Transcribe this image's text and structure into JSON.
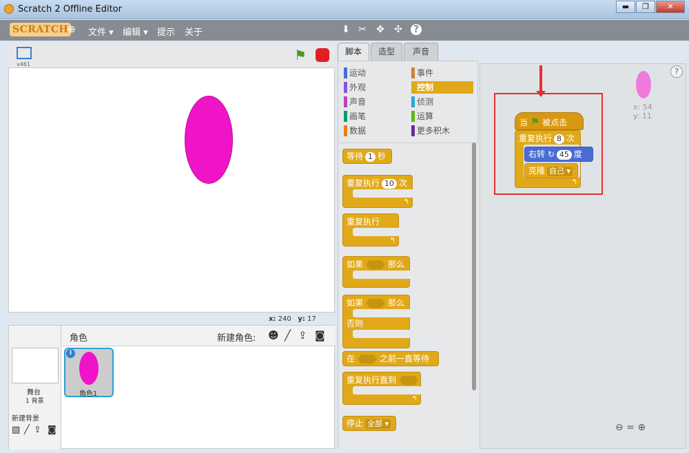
{
  "window": {
    "title": "Scratch 2 Offline Editor",
    "min": "▬",
    "max": "❐",
    "close": "✕"
  },
  "menu": {
    "logo": "SCRATCH",
    "file": "文件 ▾",
    "edit": "编辑 ▾",
    "tips": "提示",
    "about": "关于"
  },
  "stage": {
    "version": "v461",
    "coord_x_label": "x:",
    "coord_x": "240",
    "coord_y_label": "y:",
    "coord_y": "17"
  },
  "sprites": {
    "header_label": "角色",
    "new_sprite_label": "新建角色:",
    "stage_label": "舞台",
    "stage_bg_count": "1 背景",
    "new_backdrop_label": "新建背景",
    "sprite_name": "角色1",
    "info": "i"
  },
  "tabs": [
    "脚本",
    "造型",
    "声音"
  ],
  "categories": [
    {
      "label": "运动",
      "color": "#4a6cd4"
    },
    {
      "label": "事件",
      "color": "#c88330"
    },
    {
      "label": "外观",
      "color": "#8a55d7"
    },
    {
      "label": "控制",
      "color": "#e1a91a"
    },
    {
      "label": "声音",
      "color": "#bb42c3"
    },
    {
      "label": "侦测",
      "color": "#2ca5e2"
    },
    {
      "label": "画笔",
      "color": "#0e9a6c"
    },
    {
      "label": "运算",
      "color": "#5cb712"
    },
    {
      "label": "数据",
      "color": "#ee7d16"
    },
    {
      "label": "更多积木",
      "color": "#632d99"
    }
  ],
  "palette": {
    "wait": "等待",
    "wait_val": "1",
    "wait_unit": "秒",
    "repeat": "重复执行",
    "repeat_val": "10",
    "repeat_unit": "次",
    "forever": "重复执行",
    "if": "如果",
    "then": "那么",
    "if2": "如果",
    "then2": "那么",
    "else": "否则",
    "wait_until_pre": "在",
    "wait_until_post": "之前一直等待",
    "repeat_until": "重复执行直到",
    "stop": "停止",
    "stop_opt": "全部 ▾"
  },
  "script": {
    "hat_pre": "当",
    "hat_post": "被点击",
    "repeat": "重复执行",
    "repeat_val": "8",
    "repeat_unit": "次",
    "turn": "右转",
    "turn_val": "45",
    "turn_unit": "度",
    "clone": "克隆",
    "clone_opt": "自己 ▾",
    "sprite_x": "x: 54",
    "sprite_y": "y: 11",
    "help": "?"
  }
}
